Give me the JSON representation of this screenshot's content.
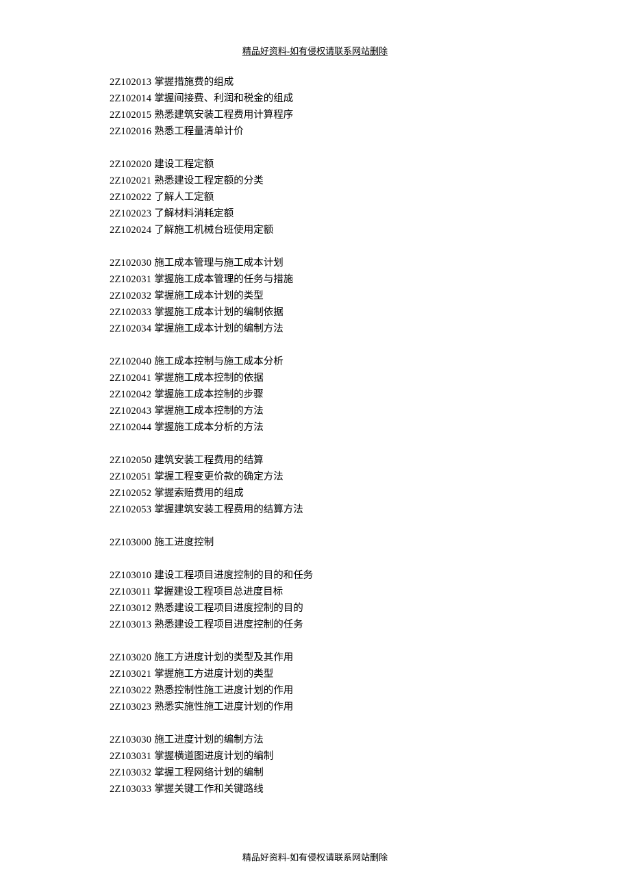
{
  "header": "精品好资料-如有侵权请联系网站删除",
  "footer": "精品好资料-如有侵权请联系网站删除",
  "groups": [
    {
      "items": [
        {
          "code": "2Z102013",
          "text": "掌握措施费的组成"
        },
        {
          "code": "2Z102014",
          "text": "掌握间接费、利润和税金的组成"
        },
        {
          "code": "2Z102015",
          "text": "熟悉建筑安装工程费用计算程序"
        },
        {
          "code": "2Z102016",
          "text": "熟悉工程量清单计价"
        }
      ]
    },
    {
      "items": [
        {
          "code": "2Z102020",
          "text": "建设工程定额"
        },
        {
          "code": "2Z102021",
          "text": "熟悉建设工程定额的分类"
        },
        {
          "code": "2Z102022",
          "text": "了解人工定额"
        },
        {
          "code": "2Z102023",
          "text": "了解材料消耗定额"
        },
        {
          "code": "2Z102024",
          "text": "了解施工机械台班使用定额"
        }
      ]
    },
    {
      "items": [
        {
          "code": "2Z102030",
          "text": "施工成本管理与施工成本计划"
        },
        {
          "code": "2Z102031",
          "text": "掌握施工成本管理的任务与措施"
        },
        {
          "code": "2Z102032",
          "text": "掌握施工成本计划的类型"
        },
        {
          "code": "2Z102033",
          "text": "掌握施工成本计划的编制依据"
        },
        {
          "code": "2Z102034",
          "text": "掌握施工成本计划的编制方法"
        }
      ]
    },
    {
      "items": [
        {
          "code": "2Z102040",
          "text": "施工成本控制与施工成本分析"
        },
        {
          "code": "2Z102041",
          "text": "掌握施工成本控制的依据"
        },
        {
          "code": "2Z102042",
          "text": "掌握施工成本控制的步骤"
        },
        {
          "code": "2Z102043",
          "text": "掌握施工成本控制的方法"
        },
        {
          "code": "2Z102044",
          "text": "掌握施工成本分析的方法"
        }
      ]
    },
    {
      "items": [
        {
          "code": "2Z102050",
          "text": "建筑安装工程费用的结算"
        },
        {
          "code": "2Z102051",
          "text": "掌握工程变更价款的确定方法"
        },
        {
          "code": "2Z102052",
          "text": "掌握索赔费用的组成"
        },
        {
          "code": "2Z102053",
          "text": "掌握建筑安装工程费用的结算方法"
        }
      ]
    },
    {
      "items": [
        {
          "code": "2Z103000",
          "text": "施工进度控制"
        }
      ]
    },
    {
      "items": [
        {
          "code": "2Z103010",
          "text": "建设工程项目进度控制的目的和任务"
        },
        {
          "code": "2Z103011",
          "text": "掌握建设工程项目总进度目标"
        },
        {
          "code": "2Z103012",
          "text": "熟悉建设工程项目进度控制的目的"
        },
        {
          "code": "2Z103013",
          "text": "熟悉建设工程项目进度控制的任务"
        }
      ]
    },
    {
      "items": [
        {
          "code": "2Z103020",
          "text": "施工方进度计划的类型及其作用"
        },
        {
          "code": "2Z103021",
          "text": "掌握施工方进度计划的类型"
        },
        {
          "code": "2Z103022",
          "text": "熟悉控制性施工进度计划的作用"
        },
        {
          "code": "2Z103023",
          "text": "熟悉实施性施工进度计划的作用"
        }
      ]
    },
    {
      "items": [
        {
          "code": "2Z103030",
          "text": "施工进度计划的编制方法"
        },
        {
          "code": "2Z103031",
          "text": "掌握横道图进度计划的编制"
        },
        {
          "code": "2Z103032",
          "text": "掌握工程网络计划的编制"
        },
        {
          "code": "2Z103033",
          "text": "掌握关键工作和关键路线"
        }
      ]
    }
  ]
}
